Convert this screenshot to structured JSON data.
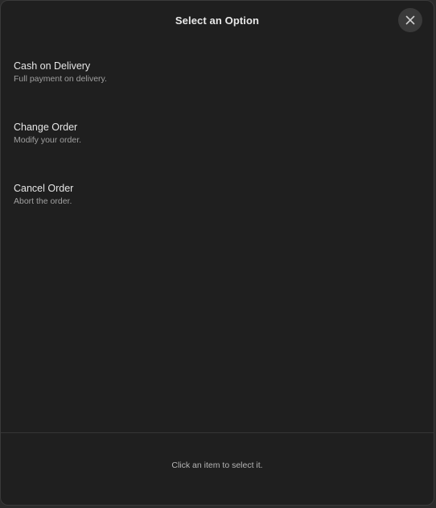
{
  "dialog": {
    "title": "Select an Option",
    "close_icon": "close-icon"
  },
  "options": [
    {
      "title": "Cash on Delivery",
      "description": "Full payment on delivery."
    },
    {
      "title": "Change Order",
      "description": "Modify your order."
    },
    {
      "title": "Cancel Order",
      "description": "Abort the order."
    }
  ],
  "footer": {
    "hint": "Click an item to select it."
  },
  "colors": {
    "background": "#1f1f1f",
    "title_text": "#e8e8e8",
    "secondary_text": "#a0a0a0",
    "close_button_bg": "#3a3a3a"
  }
}
